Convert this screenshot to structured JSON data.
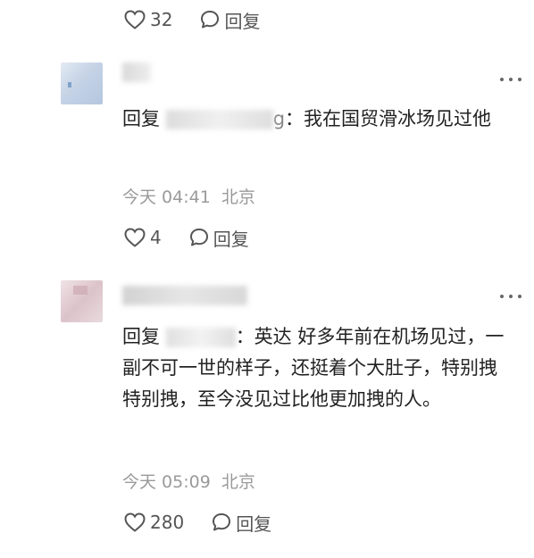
{
  "top_actions": {
    "like_count": "32",
    "reply_label": "回复"
  },
  "comments": [
    {
      "avatar_color": "#c9d6e6",
      "username_visible": "' '",
      "reply_prefix": "回复",
      "mention_visible": "H  g",
      "mention_suffix": "g",
      "text": "：我在国贸滑冰场见过他",
      "time": "今天 04:41",
      "location": "北京",
      "like_count": "4",
      "reply_label": "回复"
    },
    {
      "avatar_color": "#e6cfd4",
      "username_visible": "",
      "reply_prefix": "回复",
      "mention_visible": "S",
      "text": "：英达 好多年前在机场见过，一副不可一世的样子，还挺着个大肚子，特别拽特别拽，至今没见过比他更加拽的人。",
      "time": "今天 05:09",
      "location": "北京",
      "like_count": "280",
      "reply_label": "回复"
    }
  ],
  "icons": {
    "like": "heart-outline-icon",
    "reply": "speech-bubble-icon",
    "more": "more-dots-icon"
  }
}
